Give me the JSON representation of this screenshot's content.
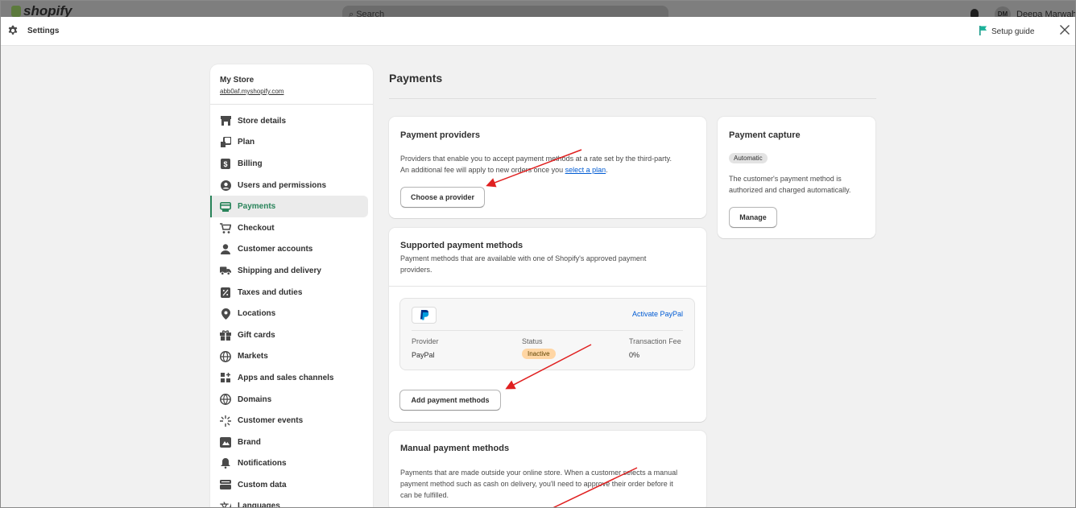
{
  "top_bar": {
    "logo": "shopify",
    "search_placeholder": "Search",
    "user_name": "Deepa Marwah",
    "user_initials": "DM"
  },
  "header": {
    "title": "Settings",
    "setup_guide": "Setup guide",
    "icons": {
      "settings": "gear-icon",
      "setup": "flag-icon",
      "close": "close-icon"
    }
  },
  "sidebar": {
    "store_name": "My Store",
    "store_url": "abb0af.myshopify.com",
    "items": [
      {
        "label": "Store details",
        "icon": "store-icon"
      },
      {
        "label": "Plan",
        "icon": "plan-icon"
      },
      {
        "label": "Billing",
        "icon": "billing-icon"
      },
      {
        "label": "Users and permissions",
        "icon": "user-icon"
      },
      {
        "label": "Payments",
        "icon": "payments-icon",
        "active": true
      },
      {
        "label": "Checkout",
        "icon": "cart-icon"
      },
      {
        "label": "Customer accounts",
        "icon": "person-icon"
      },
      {
        "label": "Shipping and delivery",
        "icon": "truck-icon"
      },
      {
        "label": "Taxes and duties",
        "icon": "tax-icon"
      },
      {
        "label": "Locations",
        "icon": "location-icon"
      },
      {
        "label": "Gift cards",
        "icon": "gift-icon"
      },
      {
        "label": "Markets",
        "icon": "globe-icon"
      },
      {
        "label": "Apps and sales channels",
        "icon": "apps-icon"
      },
      {
        "label": "Domains",
        "icon": "domain-icon"
      },
      {
        "label": "Customer events",
        "icon": "sparkle-icon"
      },
      {
        "label": "Brand",
        "icon": "brand-icon"
      },
      {
        "label": "Notifications",
        "icon": "bell-icon"
      },
      {
        "label": "Custom data",
        "icon": "data-icon"
      },
      {
        "label": "Languages",
        "icon": "language-icon"
      }
    ]
  },
  "main": {
    "title": "Payments",
    "providers": {
      "title": "Payment providers",
      "text_before_link": "Providers that enable you to accept payment methods at a rate set by the third-party. An additional fee will apply to new orders once you ",
      "link": "select a plan",
      "text_after_link": ".",
      "button": "Choose a provider"
    },
    "supported": {
      "title": "Supported payment methods",
      "text": "Payment methods that are available with one of Shopify's approved payment providers.",
      "paypal": {
        "logo_icon": "paypal-icon",
        "activate": "Activate PayPal",
        "headers": [
          "Provider",
          "Status",
          "Transaction Fee"
        ],
        "provider": "PayPal",
        "status": "Inactive",
        "fee": "0%"
      },
      "button": "Add payment methods"
    },
    "manual": {
      "title": "Manual payment methods",
      "text": "Payments that are made outside your online store. When a customer selects a manual payment method such as cash on delivery, you'll need to approve their order before it can be fulfilled."
    },
    "capture": {
      "title": "Payment capture",
      "badge": "Automatic",
      "text": "The customer's payment method is authorized and charged automatically.",
      "button": "Manage"
    }
  },
  "colors": {
    "accent_green": "#29845a",
    "link_blue": "#005bd3",
    "annotation_red": "#e02020",
    "inactive_badge": "#ffd6a4"
  }
}
